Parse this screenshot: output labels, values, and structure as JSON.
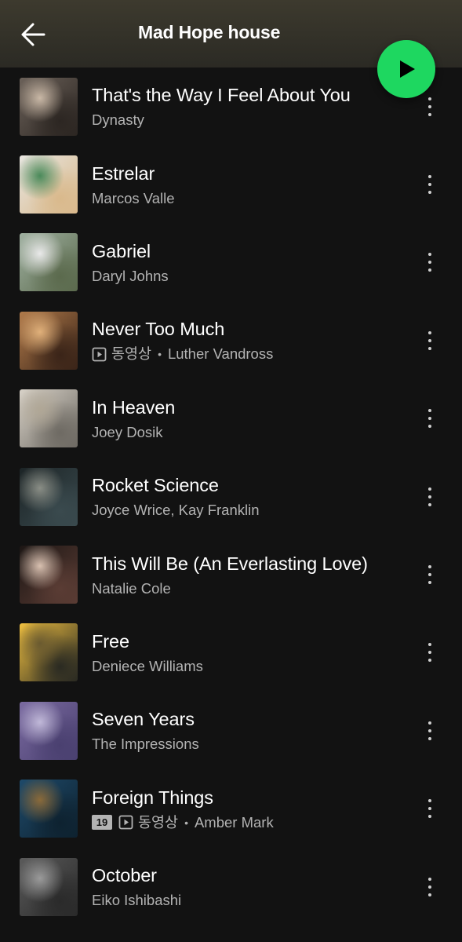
{
  "header": {
    "title": "Mad Hope house",
    "back_icon": "arrow-left-icon",
    "play_icon": "play-icon",
    "accent_color": "#1ed760"
  },
  "tracks": [
    {
      "title": "That's the Way I Feel About You",
      "artist": "Dynasty",
      "video": false,
      "explicit": false,
      "cover": [
        "#6b6159",
        "#2c2622",
        "#c9b8a6"
      ]
    },
    {
      "title": "Estrelar",
      "artist": "Marcos Valle",
      "video": false,
      "explicit": false,
      "cover": [
        "#e8e6e1",
        "#d9b98c",
        "#4a8a5a"
      ]
    },
    {
      "title": "Gabriel",
      "artist": "Daryl Johns",
      "video": false,
      "explicit": false,
      "cover": [
        "#9fb0a0",
        "#5b6a4d",
        "#e9e9e9"
      ]
    },
    {
      "title": "Never Too Much",
      "artist": "Luther Vandross",
      "video": true,
      "video_label": "동영상",
      "separator": "•",
      "explicit": false,
      "cover": [
        "#b07a4a",
        "#3a2418",
        "#e0b07a"
      ]
    },
    {
      "title": "In Heaven",
      "artist": "Joey Dosik",
      "video": false,
      "explicit": false,
      "cover": [
        "#d8d2c8",
        "#6e6a63",
        "#b0a796"
      ]
    },
    {
      "title": "Rocket Science",
      "artist": "Joyce Wrice, Kay Franklin",
      "video": false,
      "explicit": false,
      "cover": [
        "#1c2426",
        "#3a4a4e",
        "#8a8e86"
      ]
    },
    {
      "title": "This Will Be (An Everlasting Love)",
      "artist": "Natalie Cole",
      "video": false,
      "explicit": false,
      "cover": [
        "#1c1614",
        "#5a3c34",
        "#d8c0b0"
      ]
    },
    {
      "title": "Free",
      "artist": "Deniece Williams",
      "video": false,
      "explicit": false,
      "cover": [
        "#f0c040",
        "#2a2a22",
        "#6a5a30"
      ]
    },
    {
      "title": "Seven Years",
      "artist": "The Impressions",
      "video": false,
      "explicit": false,
      "cover": [
        "#7a6aa0",
        "#4a4070",
        "#c0b8d8"
      ]
    },
    {
      "title": "Foreign Things",
      "artist": "Amber Mark",
      "video": true,
      "video_label": "동영상",
      "separator": "•",
      "explicit": true,
      "explicit_label": "19",
      "cover": [
        "#1e4a6a",
        "#0e2230",
        "#8a6a3a"
      ]
    },
    {
      "title": "October",
      "artist": "Eiko Ishibashi",
      "video": false,
      "explicit": false,
      "cover": [
        "#5a5a5a",
        "#2a2a2a",
        "#9a9a9a"
      ]
    }
  ]
}
